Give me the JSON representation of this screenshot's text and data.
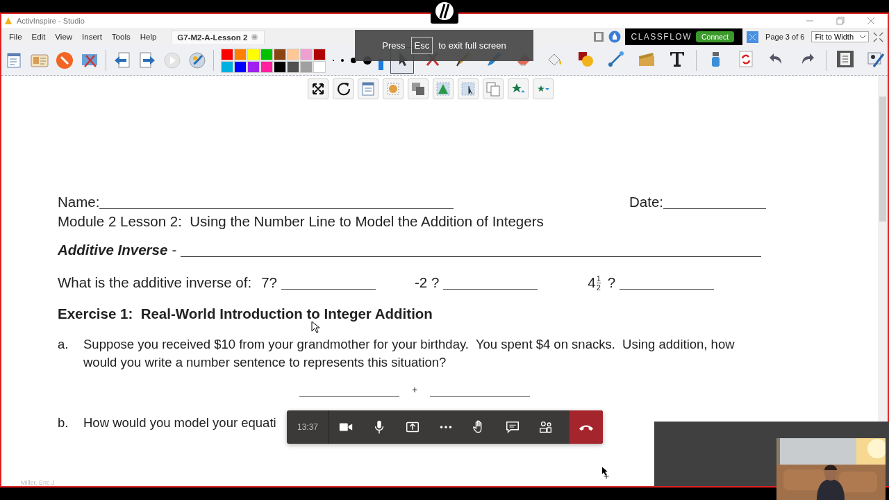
{
  "window": {
    "title": "ActivInspire - Studio"
  },
  "menu": [
    "File",
    "Edit",
    "View",
    "Insert",
    "Tools",
    "Help"
  ],
  "document_tab": {
    "label": "G7-M2-A-Lesson 2"
  },
  "classflow": {
    "brand": "CLASSFLOW",
    "button": "Connect"
  },
  "page_indicator": "Page 3 of 6",
  "zoom_select": {
    "value": "Fit to Width"
  },
  "palette": [
    {
      "color": "#ff0000"
    },
    {
      "color": "#ff8000"
    },
    {
      "color": "#ffff00"
    },
    {
      "color": "#00c000"
    },
    {
      "color": "#8b4513"
    },
    {
      "color": "#ffc896"
    },
    {
      "color": "#f0a0d0"
    },
    {
      "color": "#b00000"
    },
    {
      "color": "#00b0e0"
    },
    {
      "color": "#0000ff"
    },
    {
      "color": "#a020f0"
    },
    {
      "color": "#ff20a0"
    },
    {
      "color": "#000000"
    },
    {
      "color": "#505050"
    },
    {
      "color": "#a0a0a0"
    },
    {
      "color": "#ffffff"
    }
  ],
  "fullscreen_notice": {
    "before": "Press",
    "key": "Esc",
    "after": "to exit full screen"
  },
  "worksheet": {
    "name_label": "Name:",
    "date_label": "Date:",
    "title": "Module 2 Lesson 2:  Using the Number Line to Model the Addition of Integers",
    "term": {
      "label": "Additive Inverse",
      "separator": "-"
    },
    "question": {
      "prompt": "What is the additive inverse of:",
      "items": [
        {
          "kind": "number",
          "text": "7?"
        },
        {
          "kind": "number",
          "text": "-2 ?"
        },
        {
          "kind": "mixed",
          "whole": "4",
          "numerator": "1",
          "denominator": "2",
          "mark": "?"
        }
      ]
    },
    "exercise_heading": "Exercise 1:  Real-World Introduction to Integer Addition",
    "parts": [
      {
        "letter": "a.",
        "text": "Suppose you received $10 from your grandmother for your birthday.  You spent $4 on snacks.  Using addition, how would you write a number sentence to represents this situation?"
      },
      {
        "letter": "b.",
        "text": "How would you model your equati"
      }
    ],
    "plus": "+"
  },
  "call": {
    "time": "13:37"
  },
  "participant": {
    "name": "Miller, Eric J"
  }
}
